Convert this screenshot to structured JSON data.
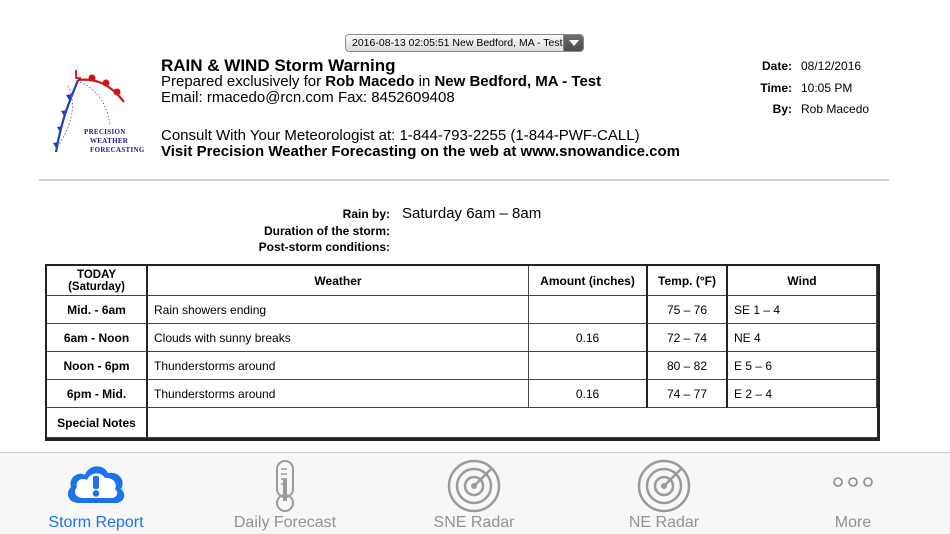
{
  "report_selector": {
    "selected": "2016-08-13 02:05:51 New Bedford, MA - Test"
  },
  "logo": {
    "line1": "PRECISION",
    "line2": "WEATHER",
    "line3": "FORECASTING"
  },
  "header": {
    "title": "RAIN & WIND Storm Warning",
    "prepared_prefix": "Prepared exclusively for ",
    "client_name": "Rob Macedo",
    "prepared_in": " in ",
    "location": "New Bedford, MA - Test",
    "email_line": "Email: rmacedo@rcn.com Fax: 8452609408",
    "consult_line": "Consult With Your Meteorologist at: 1-844-793-2255 (1-844-PWF-CALL)",
    "visit_line": "Visit Precision Weather Forecasting on the web at www.snowandice.com"
  },
  "meta": {
    "date_label": "Date:",
    "date_value": "08/12/2016",
    "time_label": "Time:",
    "time_value": "10:05 PM",
    "by_label": "By:",
    "by_value": "Rob Macedo"
  },
  "summary": {
    "rain_by_label": "Rain by:",
    "rain_by_value": "Saturday 6am – 8am",
    "duration_label": "Duration of the storm:",
    "duration_value": "",
    "post_storm_label": "Post-storm conditions:",
    "post_storm_value": ""
  },
  "table": {
    "headers": {
      "period_line1": "TODAY",
      "period_line2": "(Saturday)",
      "weather": "Weather",
      "amount": "Amount (inches)",
      "temp": "Temp. (°F)",
      "wind": "Wind"
    },
    "rows": [
      {
        "period": "Mid. - 6am",
        "weather": "Rain showers ending",
        "amount": "",
        "temp": "75 – 76",
        "wind": "SE 1 – 4"
      },
      {
        "period": "6am - Noon",
        "weather": "Clouds with sunny breaks",
        "amount": "0.16",
        "temp": "72 – 74",
        "wind": "NE 4"
      },
      {
        "period": "Noon - 6pm",
        "weather": "Thunderstorms around",
        "amount": "",
        "temp": "80 – 82",
        "wind": "E 5 – 6"
      },
      {
        "period": "6pm - Mid.",
        "weather": "Thunderstorms around",
        "amount": "0.16",
        "temp": "74 – 77",
        "wind": "E 2 – 4"
      }
    ],
    "special_notes_label": "Special Notes",
    "special_notes_value": ""
  },
  "tabbar": {
    "active_color": "#1a73e8",
    "inactive_color": "#929292",
    "tabs": [
      {
        "label": "Storm Report",
        "icon": "storm-cloud-icon",
        "active": true
      },
      {
        "label": "Daily Forecast",
        "icon": "thermometer-icon",
        "active": false
      },
      {
        "label": "SNE Radar",
        "icon": "radar-icon",
        "active": false
      },
      {
        "label": "NE Radar",
        "icon": "radar-icon",
        "active": false
      },
      {
        "label": "More",
        "icon": "more-dots-icon",
        "active": false
      }
    ]
  }
}
